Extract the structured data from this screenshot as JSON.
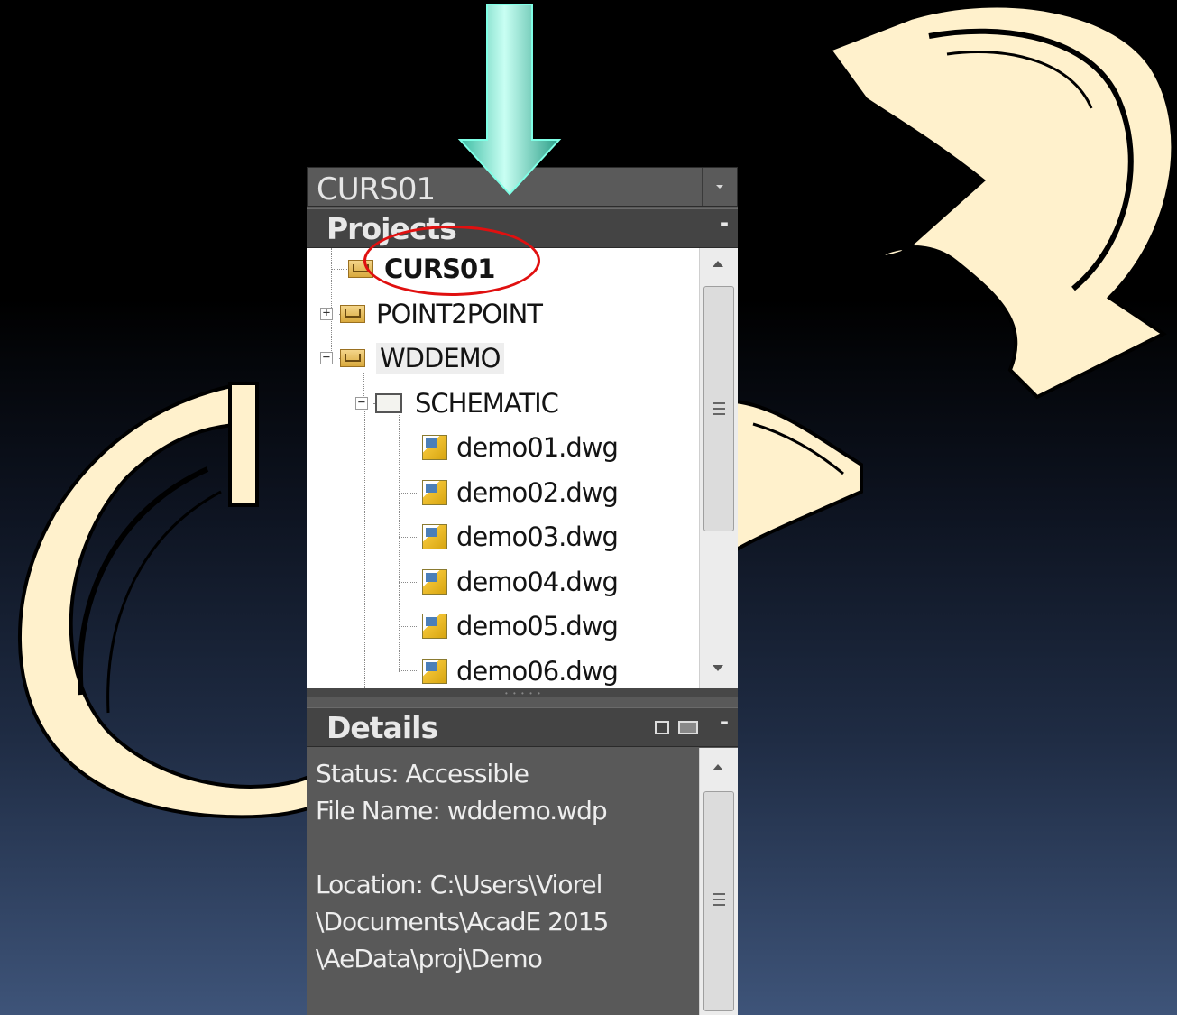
{
  "combo": {
    "value": "CURS01"
  },
  "projects": {
    "title": "Projects",
    "collapse": "-",
    "tree": [
      {
        "label": "CURS01",
        "type": "project",
        "active": true
      },
      {
        "label": "POINT2POINT",
        "type": "project",
        "expander": "+"
      },
      {
        "label": "WDDEMO",
        "type": "project",
        "expander": "−"
      },
      {
        "label": "SCHEMATIC",
        "type": "folder",
        "expander": "−"
      },
      {
        "label": "demo01.dwg",
        "type": "drawing"
      },
      {
        "label": "demo02.dwg",
        "type": "drawing"
      },
      {
        "label": "demo03.dwg",
        "type": "drawing"
      },
      {
        "label": "demo04.dwg",
        "type": "drawing"
      },
      {
        "label": "demo05.dwg",
        "type": "drawing"
      },
      {
        "label": "demo06.dwg",
        "type": "drawing"
      }
    ]
  },
  "details": {
    "title": "Details",
    "collapse": "-",
    "lines": [
      "Status: Accessible",
      "File Name: wddemo.wdp",
      "",
      "Location: C:\\Users\\Viorel",
      "\\Documents\\AcadE 2015",
      "\\AeData\\proj\\Demo"
    ]
  },
  "decor": {
    "letters": [
      "C",
      "P"
    ],
    "letter_color": "#fff1cc",
    "arrow_color": "#6fd9c2",
    "callout_color": "#e01010"
  },
  "icons": [
    "dropdown-arrow-icon",
    "project-icon",
    "folder-icon",
    "dwg-file-icon",
    "expand-icon",
    "collapse-icon",
    "details-list-icon",
    "details-preview-icon"
  ]
}
